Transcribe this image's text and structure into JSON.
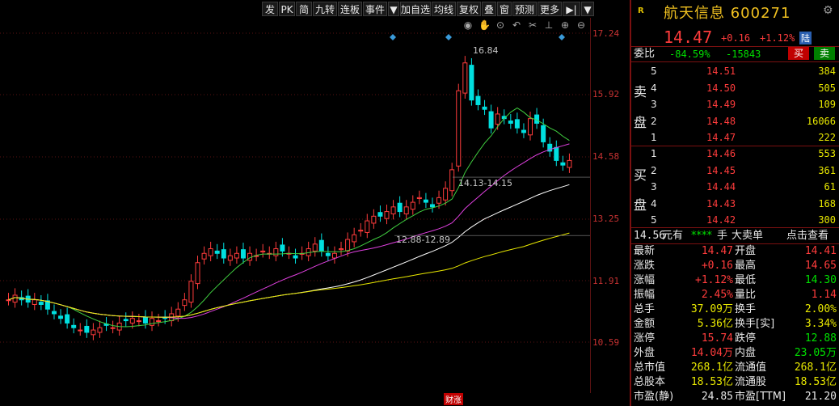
{
  "toolbar": {
    "buttons": [
      "发",
      "PK",
      "简",
      "九转",
      "连板",
      "事件",
      "▼",
      "加自选",
      "均线",
      "复权",
      "叠",
      "窗",
      "预测",
      "更多",
      "▶|",
      "▼"
    ]
  },
  "chart": {
    "price_ticks": [
      "17.24",
      "15.92",
      "14.58",
      "13.25",
      "11.91",
      "10.59"
    ],
    "high_label": "16.84",
    "gap_label_1": "14.13-14.15",
    "gap_label_2": "12.88-12.89",
    "bottom_marker": "财涨",
    "icons": [
      "eye-icon",
      "hand-icon",
      "play-icon",
      "undo-icon",
      "scissors-icon",
      "pin-icon",
      "zoom-in-icon",
      "zoom-out-icon"
    ]
  },
  "quote": {
    "badge": "R",
    "name": "航天信息",
    "code": "600271",
    "price": "14.47",
    "change": "+0.16",
    "change_pct": "+1.12%",
    "lu_badge": "陆",
    "weibi_label": "委比",
    "weibi_pct": "-84.59%",
    "weibi_diff": "-15843",
    "buy_btn": "买",
    "sell_btn": "卖",
    "sell_label": [
      "卖",
      "盘"
    ],
    "buy_label": [
      "买",
      "盘"
    ],
    "asks": [
      {
        "lvl": "5",
        "price": "14.51",
        "vol": "384"
      },
      {
        "lvl": "4",
        "price": "14.50",
        "vol": "505"
      },
      {
        "lvl": "3",
        "price": "14.49",
        "vol": "109"
      },
      {
        "lvl": "2",
        "price": "14.48",
        "vol": "16066"
      },
      {
        "lvl": "1",
        "price": "14.47",
        "vol": "222"
      }
    ],
    "bids": [
      {
        "lvl": "1",
        "price": "14.46",
        "vol": "553"
      },
      {
        "lvl": "2",
        "price": "14.45",
        "vol": "361"
      },
      {
        "lvl": "3",
        "price": "14.44",
        "vol": "61"
      },
      {
        "lvl": "4",
        "price": "14.43",
        "vol": "168"
      },
      {
        "lvl": "5",
        "price": "14.42",
        "vol": "300"
      }
    ],
    "big_order": {
      "price": "14.56",
      "unit": "元有",
      "stars": "****",
      "unit2": "手",
      "label": "大卖单",
      "link": "点击查看"
    },
    "stats": [
      {
        "l1": "最新",
        "v1": "14.47",
        "c1": "red",
        "l2": "开盘",
        "v2": "14.41",
        "c2": "red"
      },
      {
        "l1": "涨跌",
        "v1": "+0.16",
        "c1": "red",
        "l2": "最高",
        "v2": "14.65",
        "c2": "red"
      },
      {
        "l1": "涨幅",
        "v1": "+1.12%",
        "c1": "red",
        "l2": "最低",
        "v2": "14.30",
        "c2": "green"
      },
      {
        "l1": "振幅",
        "v1": "2.45%",
        "c1": "red",
        "l2": "量比",
        "v2": "1.14",
        "c2": "red"
      },
      {
        "l1": "总手",
        "v1": "37.09万",
        "c1": "yellow",
        "l2": "换手",
        "v2": "2.00%",
        "c2": "yellow"
      },
      {
        "l1": "金额",
        "v1": "5.36亿",
        "c1": "yellow",
        "l2": "换手[实]",
        "v2": "3.34%",
        "c2": "yellow"
      },
      {
        "l1": "涨停",
        "v1": "15.74",
        "c1": "red",
        "l2": "跌停",
        "v2": "12.88",
        "c2": "green"
      },
      {
        "l1": "外盘",
        "v1": "14.04万",
        "c1": "red",
        "l2": "内盘",
        "v2": "23.05万",
        "c2": "green"
      },
      {
        "l1": "总市值",
        "v1": "268.1亿",
        "c1": "yellow",
        "l2": "流通值",
        "v2": "268.1亿",
        "c2": "yellow"
      },
      {
        "l1": "总股本",
        "v1": "18.53亿",
        "c1": "yellow",
        "l2": "流通股",
        "v2": "18.53亿",
        "c2": "yellow"
      },
      {
        "l1": "市盈(静)",
        "v1": "24.85",
        "c1": "white",
        "l2": "市盈[TTM]",
        "v2": "21.20",
        "c2": "white"
      }
    ]
  },
  "colors": {
    "up": "#ff3c3c",
    "down": "#00e0e0",
    "ma5": "#ffffff",
    "ma10": "#e8e800",
    "ma20": "#e040e0",
    "ma60": "#40d040"
  }
}
